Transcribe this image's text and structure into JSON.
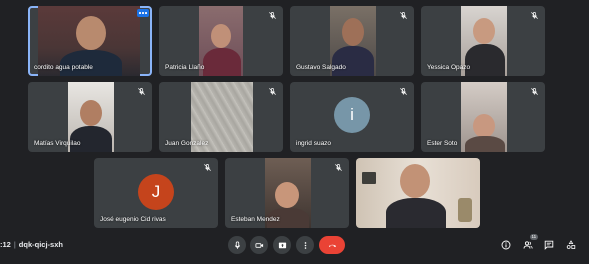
{
  "meeting": {
    "time_fragment": ":12",
    "code": "dqk-qicj-sxh"
  },
  "participants": [
    {
      "name": "cordito agua potable"
    },
    {
      "name": "Patricia Llaño"
    },
    {
      "name": "Gustavo Salgado"
    },
    {
      "name": "Yessica Opazo"
    },
    {
      "name": "Matías Virquilao"
    },
    {
      "name": "Juan Gonzalez"
    },
    {
      "name": "ingrid suazo",
      "avatar_letter": "i",
      "avatar_color": "#7796a8"
    },
    {
      "name": "Ester Soto"
    },
    {
      "name": "José eugenio Cid rivas",
      "avatar_letter": "J",
      "avatar_color": "#c5441c"
    },
    {
      "name": "Esteban Mendez"
    },
    {
      "name": ""
    }
  ],
  "controls": {
    "participant_count": "11"
  },
  "colors": {
    "background": "#202124",
    "tile": "#3c4043",
    "active_outline": "#8ab4f8",
    "end_call": "#ea4335"
  }
}
